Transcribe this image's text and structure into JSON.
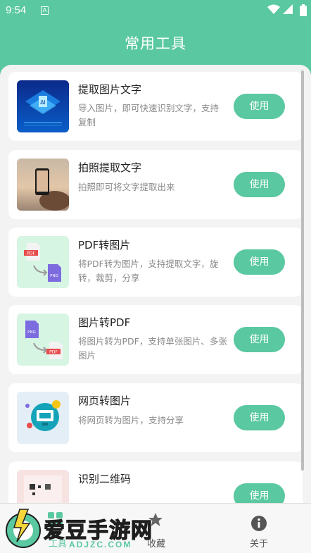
{
  "status_bar": {
    "time": "9:54",
    "notification_icon": "A"
  },
  "header": {
    "title": "常用工具"
  },
  "tools": [
    {
      "title": "提取图片文字",
      "desc": "导入图片，即可快速识别文字，支持复制",
      "button": "使用",
      "icon": "chip-ai-icon"
    },
    {
      "title": "拍照提取文字",
      "desc": "拍照即可将文字提取出来",
      "button": "使用",
      "icon": "camera-photo-icon"
    },
    {
      "title": "PDF转图片",
      "desc": "将PDF转为图片，支持提取文字，旋转，裁剪，分享",
      "button": "使用",
      "icon": "pdf-to-png-icon"
    },
    {
      "title": "图片转PDF",
      "desc": "将图片转为PDF，支持单张图片、多张图片",
      "button": "使用",
      "icon": "png-to-pdf-icon"
    },
    {
      "title": "网页转图片",
      "desc": "将网页转为图片，支持分享",
      "button": "使用",
      "icon": "webpage-icon"
    },
    {
      "title": "识别二维码",
      "desc": "",
      "button": "使用",
      "icon": "qrcode-icon"
    }
  ],
  "nav": {
    "tools": "工具",
    "favorites": "收藏",
    "about": "关于"
  },
  "watermark": {
    "text": "爱豆手游网",
    "url": "ADJZC.COM"
  },
  "colors": {
    "accent": "#5ac8a0",
    "background": "#f3f3f3"
  }
}
